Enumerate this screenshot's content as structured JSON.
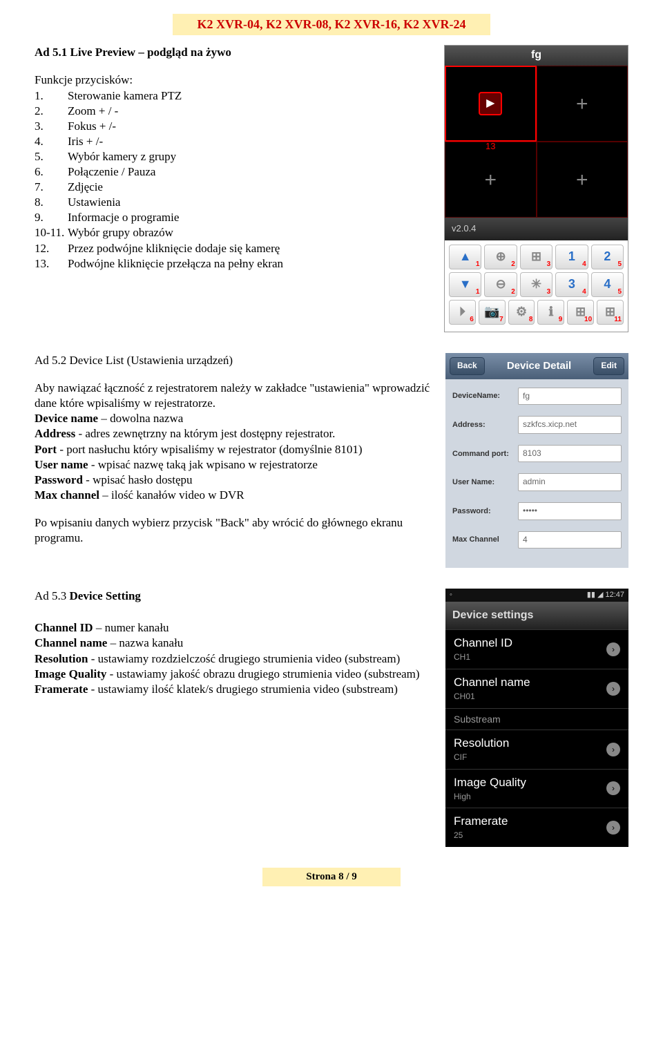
{
  "header": "K2 XVR-04, K2 XVR-08, K2 XVR-16, K2 XVR-24",
  "sec1": {
    "title_prefix": "Ad 5.1 ",
    "title_bold": "Live Preview",
    "title_suffix": " – podgląd na żywo",
    "func_label": "Funkcje przycisków:",
    "items": [
      "Sterowanie kamera PTZ",
      "Zoom + / -",
      "Fokus + /-",
      "Iris + /-",
      "Wybór kamery z grupy",
      "Połączenie / Pauza",
      "Zdjęcie",
      "Ustawienia",
      "Informacje o programie",
      "Wybór grupy obrazów",
      "Przez podwójne kliknięcie dodaje się kamerę",
      "Podwójne kliknięcie przełącza na pełny ekran"
    ],
    "item_nums": [
      "1.",
      "2.",
      "3.",
      "4.",
      "5.",
      "6.",
      "7.",
      "8.",
      "9.",
      "10-11.",
      "12.",
      "13."
    ]
  },
  "mock1": {
    "title": "fg",
    "num13": "13",
    "version": "v2.0.4",
    "btn_nums_row1": [
      "1",
      "2",
      "3",
      "4",
      "5"
    ],
    "btn_nums_row2": [
      "1",
      "2",
      "3",
      "4",
      "5"
    ],
    "btn_nums_row3": [
      "6",
      "7",
      "8",
      "9",
      "10",
      "11"
    ]
  },
  "sec2": {
    "title_prefix": "Ad 5.2 ",
    "title_main": "Device List (Ustawienia urządzeń)",
    "intro": "Aby nawiązać łączność z rejestratorem należy w zakładce \"ustawienia\" wprowadzić  dane które wpisaliśmy w rejestratorze.",
    "lines": [
      {
        "b": "Device name",
        "t": " – dowolna nazwa"
      },
      {
        "b": "Address",
        "t": " - adres zewnętrzny na którym jest dostępny rejestrator."
      },
      {
        "b": "Port",
        "t": " - port nasłuchu który wpisaliśmy w rejestrator (domyślnie 8101)"
      },
      {
        "b": "User name",
        "t": " - wpisać nazwę taką jak wpisano w rejestratorze"
      },
      {
        "b": "Password",
        "t": " - wpisać hasło dostępu"
      },
      {
        "b": "Max channel",
        "t": " – ilość kanałów video w DVR"
      }
    ],
    "outro": "Po wpisaniu danych wybierz przycisk \"Back\" aby wrócić do  głównego ekranu programu."
  },
  "mock2": {
    "back": "Back",
    "title": "Device Detail",
    "edit": "Edit",
    "fields": [
      {
        "label": "DeviceName:",
        "value": "fg"
      },
      {
        "label": "Address:",
        "value": "szkfcs.xicp.net"
      },
      {
        "label": "Command port:",
        "value": "8103"
      },
      {
        "label": "User Name:",
        "value": "admin"
      },
      {
        "label": "Password:",
        "value": "•••••"
      },
      {
        "label": "Max Channel",
        "value": "4"
      }
    ]
  },
  "sec3": {
    "title_prefix": "Ad 5.3 ",
    "title_bold": "Device Setting",
    "lines": [
      {
        "b": "Channel ID",
        "t": " – numer kanału"
      },
      {
        "b": "Channel name",
        "t": " – nazwa kanału"
      },
      {
        "b": "Resolution",
        "t": " - ustawiamy rozdzielczość drugiego strumienia video (substream)"
      },
      {
        "b": "Image Quality",
        "t": " - ustawiamy jakość obrazu drugiego strumienia video (substream)"
      },
      {
        "b": "Framerate",
        "t": " - ustawiamy ilość klatek/s drugiego strumienia video (substream)"
      }
    ]
  },
  "mock3": {
    "time": "12:47",
    "head": "Device settings",
    "items": [
      {
        "main": "Channel ID",
        "sub": "CH1",
        "chev": true
      },
      {
        "main": "Channel name",
        "sub": "CH01",
        "chev": true
      },
      {
        "main": "Substream",
        "sub": "",
        "chev": false,
        "gray": true
      },
      {
        "main": "Resolution",
        "sub": "CIF",
        "chev": true
      },
      {
        "main": "Image Quality",
        "sub": "High",
        "chev": true
      },
      {
        "main": "Framerate",
        "sub": "25",
        "chev": true
      }
    ]
  },
  "footer": "Strona 8 / 9"
}
